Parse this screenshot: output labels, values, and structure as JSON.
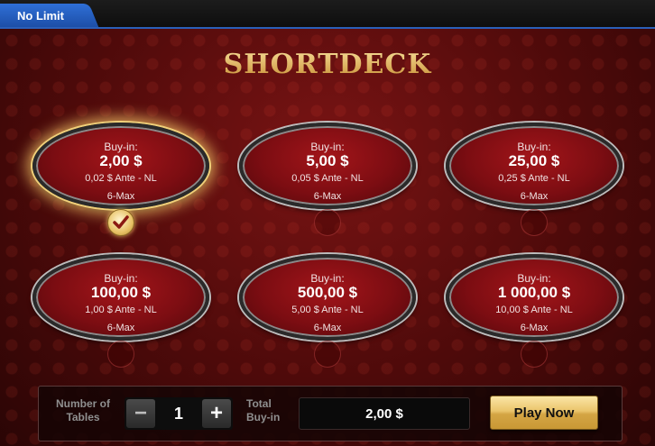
{
  "tab": {
    "label": "No Limit"
  },
  "logo": {
    "text": "SHORTDECK"
  },
  "tables": [
    {
      "buyin_label": "Buy-in:",
      "buyin": "2,00 $",
      "ante": "0,02 $ Ante - NL",
      "max": "6-Max",
      "selected": true
    },
    {
      "buyin_label": "Buy-in:",
      "buyin": "5,00 $",
      "ante": "0,05 $ Ante - NL",
      "max": "6-Max",
      "selected": false
    },
    {
      "buyin_label": "Buy-in:",
      "buyin": "25,00 $",
      "ante": "0,25 $ Ante - NL",
      "max": "6-Max",
      "selected": false
    },
    {
      "buyin_label": "Buy-in:",
      "buyin": "100,00 $",
      "ante": "1,00 $ Ante - NL",
      "max": "6-Max",
      "selected": false
    },
    {
      "buyin_label": "Buy-in:",
      "buyin": "500,00 $",
      "ante": "5,00 $ Ante - NL",
      "max": "6-Max",
      "selected": false
    },
    {
      "buyin_label": "Buy-in:",
      "buyin": "1 000,00 $",
      "ante": "10,00 $ Ante - NL",
      "max": "6-Max",
      "selected": false
    }
  ],
  "bottom": {
    "num_tables_label": "Number of Tables",
    "minus": "−",
    "plus": "+",
    "num_tables_value": "1",
    "total_buyin_label": "Total Buy-in",
    "total_buyin_value": "2,00 $",
    "play_label": "Play Now"
  },
  "colors": {
    "tab_blue": "#2f6fd6",
    "gold": "#e6b55c",
    "felt": "#7c0d12"
  }
}
